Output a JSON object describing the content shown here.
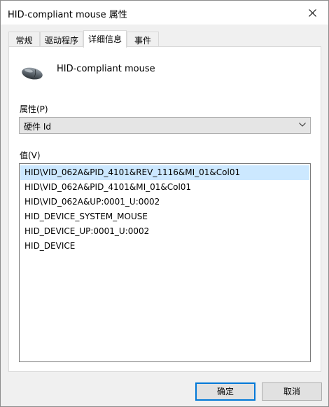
{
  "window": {
    "title": "HID-compliant mouse 属性"
  },
  "tabs": [
    {
      "label": "常规"
    },
    {
      "label": "驱动程序"
    },
    {
      "label": "详细信息"
    },
    {
      "label": "事件"
    }
  ],
  "active_tab": "详细信息",
  "device": {
    "icon": "mouse-icon",
    "name": "HID-compliant mouse"
  },
  "property": {
    "label": "属性(P)",
    "selected": "硬件 Id"
  },
  "value": {
    "label": "值(V)",
    "items": [
      "HID\\VID_062A&PID_4101&REV_1116&MI_01&Col01",
      "HID\\VID_062A&PID_4101&MI_01&Col01",
      "HID\\VID_062A&UP:0001_U:0002",
      "HID_DEVICE_SYSTEM_MOUSE",
      "HID_DEVICE_UP:0001_U:0002",
      "HID_DEVICE"
    ],
    "selected_index": 0
  },
  "buttons": {
    "ok": "确定",
    "cancel": "取消"
  },
  "colors": {
    "accent": "#0078d7",
    "selection": "#cce8ff"
  }
}
